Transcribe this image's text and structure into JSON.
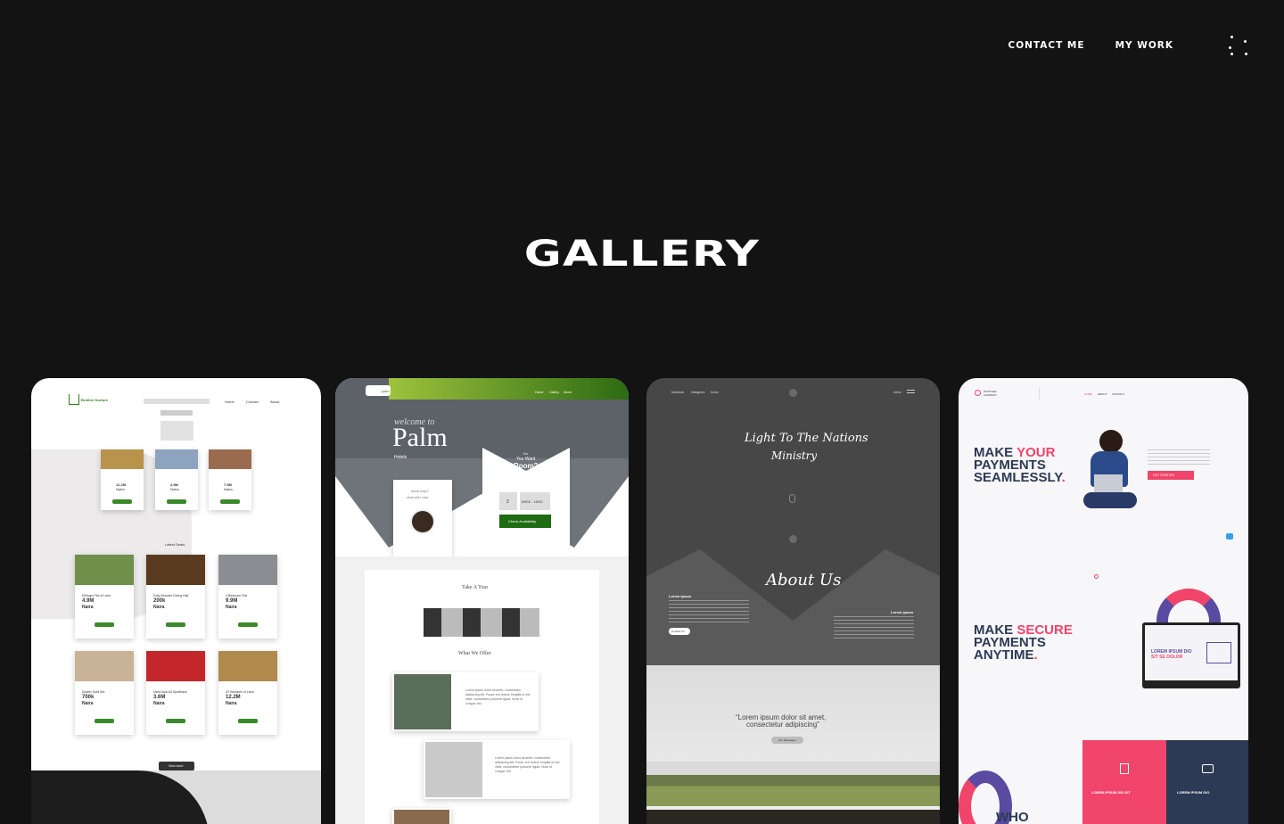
{
  "nav": {
    "contact": "CONTACT ME",
    "work": "MY WORK"
  },
  "gallery": {
    "title": "GALLERY"
  },
  "card1": {
    "logo": "Brother Nurture",
    "menu": [
      "Home",
      "Contact",
      "About"
    ],
    "search_placeholder": "Search Locations",
    "latest": "Latest Deals",
    "view_more": "View more",
    "deals_top": [
      {
        "price": "12.2M",
        "unit": "Naira"
      },
      {
        "price": "4.9M",
        "unit": "Naira"
      },
      {
        "price": "7.9M",
        "unit": "Naira"
      }
    ],
    "deals": [
      {
        "name": "600sqm Plot of Land",
        "price": "4.9M",
        "unit": "Naira"
      },
      {
        "name": "Fully Wooden Dining Hall",
        "price": "200k",
        "unit": "Naira"
      },
      {
        "name": "4 Bedroom Flat",
        "price": "9.9M",
        "unit": "Naira"
      },
      {
        "name": "Duplex Sofa Set",
        "price": "700k",
        "unit": "Naira"
      },
      {
        "name": "Used Audi A3 Sportback",
        "price": "3.6M",
        "unit": "Naira"
      },
      {
        "name": "20 Hectares of Land",
        "price": "12.2M",
        "unit": "Naira"
      }
    ]
  },
  "card2": {
    "brand": "palm",
    "nav": [
      "Home",
      "Gallery",
      "About"
    ],
    "welcome": "welcome to",
    "name": "Palm",
    "sub": "Hotels",
    "help": "need help?",
    "chat": "chat with Lisa",
    "room_q1": "Do",
    "room_q2": "You Want",
    "room_q3": "Room?",
    "guests_value": "2",
    "date_value": "09/02 - 10/02",
    "check": "Check Availability",
    "tour": "Take A Tour",
    "offer": "What We Offer",
    "lorem": "Lorem ipsum dolor sit amet, consectetur adipiscing elit. Fusce orci lectus, fringilla ut nisl vitae, consectetur posuere ligula. Nunc id congue nisl"
  },
  "card3": {
    "nav": [
      "facebook",
      "instagram",
      "forum"
    ],
    "menu": "menu",
    "title1": "Light To The Nations",
    "title2": "Ministry",
    "about": "About Us",
    "lorem_head": "Lorem ipsum",
    "contact": "Contact Us",
    "quote1": "“Lorem ipsum dolor sit amet,",
    "quote2": "consectetur adipiscing”",
    "message": "Our Messages"
  },
  "card4": {
    "brand": "UNTITLED COMPANY",
    "menu": [
      "HOME",
      "ABOUT",
      "CONTACT"
    ],
    "h1a": "MAKE ",
    "h1b": "YOUR",
    "h1c": "PAYMENTS",
    "h1d": "SEAMLESSLY",
    "cta": "GET STARTED",
    "h2a": "MAKE ",
    "h2b": "SECURE",
    "h2c": "PAYMENTS",
    "h2d": "ANYTIME",
    "screen1": "LOREM IPSUM DIO",
    "screen2": "SIT SE DOLOR",
    "box1": "LOREM IPSUM DIO SIT",
    "box2": "LOREM IPSUM DIO",
    "who": "WHO",
    "accent": "#f0446b",
    "navy": "#2c3a55"
  }
}
